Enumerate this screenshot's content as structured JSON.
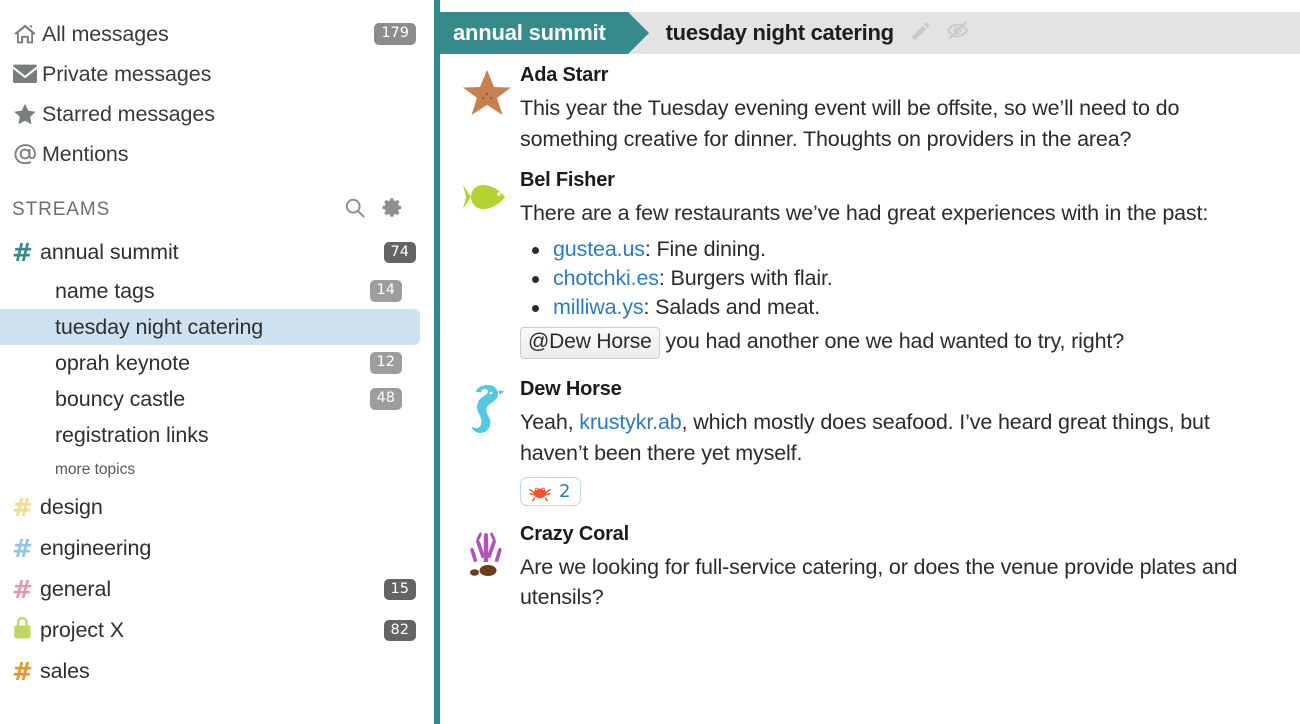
{
  "sidebar": {
    "nav": [
      {
        "label": "All messages",
        "icon": "home-icon",
        "count": "179"
      },
      {
        "label": "Private messages",
        "icon": "envelope-icon",
        "count": ""
      },
      {
        "label": "Starred messages",
        "icon": "star-icon",
        "count": ""
      },
      {
        "label": "Mentions",
        "icon": "at-icon",
        "count": ""
      }
    ],
    "streams_header": {
      "title": "STREAMS",
      "search_icon": "search-icon",
      "gear_icon": "gear-icon"
    },
    "streams": [
      {
        "name": "annual summit",
        "icon": "hash-icon",
        "color": "#338a8c",
        "count": "74"
      },
      {
        "name": "design",
        "icon": "hash-icon",
        "color": "#f3dc89",
        "count": ""
      },
      {
        "name": "engineering",
        "icon": "hash-icon",
        "color": "#92c5e8",
        "count": ""
      },
      {
        "name": "general",
        "icon": "hash-icon",
        "color": "#dd9ab5",
        "count": "15"
      },
      {
        "name": "project X",
        "icon": "lock-icon",
        "color": "#bcd766",
        "count": "82"
      },
      {
        "name": "sales",
        "icon": "hash-icon",
        "color": "#f29124",
        "count": ""
      }
    ],
    "topics": [
      {
        "name": "name tags",
        "count": "14",
        "selected": false
      },
      {
        "name": "tuesday night catering",
        "count": "",
        "selected": true
      },
      {
        "name": "oprah keynote",
        "count": "12",
        "selected": false
      },
      {
        "name": "bouncy castle",
        "count": "48",
        "selected": false
      },
      {
        "name": "registration links",
        "count": "",
        "selected": false
      }
    ],
    "more_topics_label": "more topics",
    "colors": {
      "selected_topic_bg": "#cde1f0",
      "badge_default": "#8a8d8b",
      "badge_dark": "#646464",
      "badge_mid": "#9b9e9c"
    }
  },
  "header": {
    "stream_label": "annual summit",
    "topic_label": "tuesday night catering",
    "edit_icon": "pencil-icon",
    "mute_icon": "eye-slash-icon",
    "stream_color": "#368a8c",
    "bar_color": "#e3e3e3"
  },
  "messages": [
    {
      "sender": "Ada Starr",
      "avatar": "starfish-avatar",
      "text": "This year the Tuesday evening event will be offsite, so we’ll need to do something creative for dinner. Thoughts on providers in the area?"
    },
    {
      "sender": "Bel Fisher",
      "avatar": "fish-avatar",
      "intro": "There are a few restaurants we’ve had great experiences with in the past:",
      "list": [
        {
          "link": "gustea.us",
          "rest": ": Fine dining."
        },
        {
          "link": "chotchki.es",
          "rest": ": Burgers with flair."
        },
        {
          "link": "milliwa.ys",
          "rest": ": Salads and meat."
        }
      ],
      "mention": "@Dew Horse",
      "after_mention": " you had another one we had wanted to try, right?"
    },
    {
      "sender": "Dew Horse",
      "avatar": "seahorse-avatar",
      "text_before": "Yeah, ",
      "link": "krustykr.ab",
      "text_after": ", which mostly does seafood. I’ve heard great things, but haven’t been there yet myself.",
      "reaction": {
        "emoji": "crab-emoji",
        "count": "2"
      }
    },
    {
      "sender": "Crazy Coral",
      "avatar": "coral-avatar",
      "text": "Are we looking for full-service catering, or does the venue provide plates and utensils?"
    }
  ],
  "accent_bar_color": "#338a8c"
}
